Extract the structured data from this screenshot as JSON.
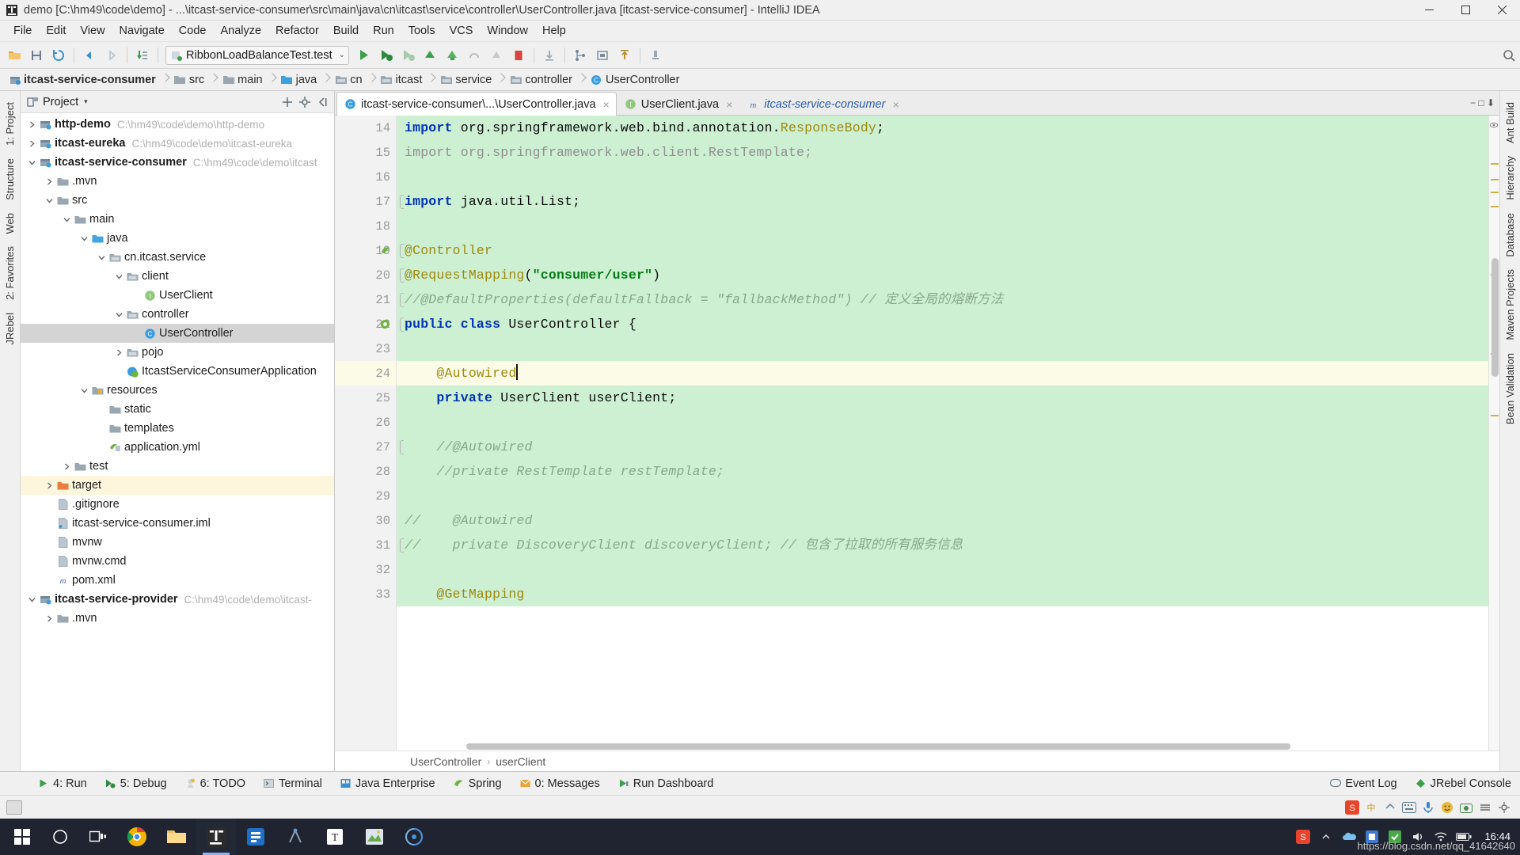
{
  "window": {
    "title": "demo [C:\\hm49\\code\\demo] - ...\\itcast-service-consumer\\src\\main\\java\\cn\\itcast\\service\\controller\\UserController.java [itcast-service-consumer] - IntelliJ IDEA",
    "minimize": "—",
    "maximize": "❐",
    "close": "✕"
  },
  "menu": [
    "File",
    "Edit",
    "View",
    "Navigate",
    "Code",
    "Analyze",
    "Refactor",
    "Build",
    "Run",
    "Tools",
    "VCS",
    "Window",
    "Help"
  ],
  "toolbar": {
    "run_config": "RibbonLoadBalanceTest.test",
    "dropdown_arrow": "⌄"
  },
  "breadcrumb": [
    {
      "label": "itcast-service-consumer",
      "icon": "module-icon",
      "bold": true
    },
    {
      "label": "src",
      "icon": "folder-icon",
      "bold": false
    },
    {
      "label": "main",
      "icon": "folder-icon",
      "bold": false
    },
    {
      "label": "java",
      "icon": "source-folder-icon",
      "bold": false
    },
    {
      "label": "cn",
      "icon": "package-icon",
      "bold": false
    },
    {
      "label": "itcast",
      "icon": "package-icon",
      "bold": false
    },
    {
      "label": "service",
      "icon": "package-icon",
      "bold": false
    },
    {
      "label": "controller",
      "icon": "package-icon",
      "bold": false
    },
    {
      "label": "UserController",
      "icon": "class-icon",
      "bold": false
    }
  ],
  "left_strip": [
    "1: Project",
    "Structure",
    "Web",
    "2: Favorites",
    "JRebel"
  ],
  "right_strip": [
    "Ant Build",
    "Hierarchy",
    "Database",
    "Maven Projects",
    "Bean Validation"
  ],
  "project_panel": {
    "title": "Project",
    "caret": "▾",
    "tree": [
      {
        "depth": 0,
        "arrow": "right",
        "icon": "module-icon",
        "label": "http-demo",
        "path": "C:\\hm49\\code\\demo\\http-demo",
        "bold": true,
        "state": ""
      },
      {
        "depth": 0,
        "arrow": "right",
        "icon": "module-icon",
        "label": "itcast-eureka",
        "path": "C:\\hm49\\code\\demo\\itcast-eureka",
        "bold": true,
        "state": ""
      },
      {
        "depth": 0,
        "arrow": "down",
        "icon": "module-icon",
        "label": "itcast-service-consumer",
        "path": "C:\\hm49\\code\\demo\\itcast",
        "bold": true,
        "state": ""
      },
      {
        "depth": 1,
        "arrow": "right",
        "icon": "folder-icon",
        "label": ".mvn",
        "path": "",
        "bold": false,
        "state": ""
      },
      {
        "depth": 1,
        "arrow": "down",
        "icon": "folder-icon",
        "label": "src",
        "path": "",
        "bold": false,
        "state": ""
      },
      {
        "depth": 2,
        "arrow": "down",
        "icon": "folder-icon",
        "label": "main",
        "path": "",
        "bold": false,
        "state": ""
      },
      {
        "depth": 3,
        "arrow": "down",
        "icon": "source-folder-icon",
        "label": "java",
        "path": "",
        "bold": false,
        "state": ""
      },
      {
        "depth": 4,
        "arrow": "down",
        "icon": "package-icon",
        "label": "cn.itcast.service",
        "path": "",
        "bold": false,
        "state": ""
      },
      {
        "depth": 5,
        "arrow": "down",
        "icon": "package-icon",
        "label": "client",
        "path": "",
        "bold": false,
        "state": ""
      },
      {
        "depth": 6,
        "arrow": "none",
        "icon": "interface-icon",
        "label": "UserClient",
        "path": "",
        "bold": false,
        "state": ""
      },
      {
        "depth": 5,
        "arrow": "down",
        "icon": "package-icon",
        "label": "controller",
        "path": "",
        "bold": false,
        "state": ""
      },
      {
        "depth": 6,
        "arrow": "none",
        "icon": "class-icon",
        "label": "UserController",
        "path": "",
        "bold": false,
        "state": "selected"
      },
      {
        "depth": 5,
        "arrow": "right",
        "icon": "package-icon",
        "label": "pojo",
        "path": "",
        "bold": false,
        "state": ""
      },
      {
        "depth": 5,
        "arrow": "none",
        "icon": "spring-class-icon",
        "label": "ItcastServiceConsumerApplication",
        "path": "",
        "bold": false,
        "state": ""
      },
      {
        "depth": 3,
        "arrow": "down",
        "icon": "resources-icon",
        "label": "resources",
        "path": "",
        "bold": false,
        "state": ""
      },
      {
        "depth": 4,
        "arrow": "none",
        "icon": "folder-icon",
        "label": "static",
        "path": "",
        "bold": false,
        "state": ""
      },
      {
        "depth": 4,
        "arrow": "none",
        "icon": "folder-icon",
        "label": "templates",
        "path": "",
        "bold": false,
        "state": ""
      },
      {
        "depth": 4,
        "arrow": "none",
        "icon": "yml-icon",
        "label": "application.yml",
        "path": "",
        "bold": false,
        "state": ""
      },
      {
        "depth": 2,
        "arrow": "right",
        "icon": "folder-icon",
        "label": "test",
        "path": "",
        "bold": false,
        "state": ""
      },
      {
        "depth": 1,
        "arrow": "right",
        "icon": "target-folder-icon",
        "label": "target",
        "path": "",
        "bold": false,
        "state": "highlight"
      },
      {
        "depth": 1,
        "arrow": "none",
        "icon": "file-icon",
        "label": ".gitignore",
        "path": "",
        "bold": false,
        "state": ""
      },
      {
        "depth": 1,
        "arrow": "none",
        "icon": "iml-icon",
        "label": "itcast-service-consumer.iml",
        "path": "",
        "bold": false,
        "state": ""
      },
      {
        "depth": 1,
        "arrow": "none",
        "icon": "file-icon",
        "label": "mvnw",
        "path": "",
        "bold": false,
        "state": ""
      },
      {
        "depth": 1,
        "arrow": "none",
        "icon": "file-icon",
        "label": "mvnw.cmd",
        "path": "",
        "bold": false,
        "state": ""
      },
      {
        "depth": 1,
        "arrow": "none",
        "icon": "maven-icon",
        "label": "pom.xml",
        "path": "",
        "bold": false,
        "state": ""
      },
      {
        "depth": 0,
        "arrow": "down",
        "icon": "module-icon",
        "label": "itcast-service-provider",
        "path": "C:\\hm49\\code\\demo\\itcast-",
        "bold": true,
        "state": ""
      },
      {
        "depth": 1,
        "arrow": "right",
        "icon": "folder-icon",
        "label": ".mvn",
        "path": "",
        "bold": false,
        "state": ""
      }
    ]
  },
  "editor": {
    "tabs": [
      {
        "label": "itcast-service-consumer\\...\\UserController.java",
        "icon": "class-icon",
        "active": true,
        "close": "×",
        "italic": false
      },
      {
        "label": "UserClient.java",
        "icon": "interface-icon",
        "active": false,
        "close": "×",
        "italic": false
      },
      {
        "label": "itcast-service-consumer",
        "icon": "maven-icon",
        "active": false,
        "close": "×",
        "italic": true
      }
    ],
    "tabs_right": "− □ ⬇",
    "first_line_number": 14,
    "lines": [
      {
        "n": 14,
        "fold": false,
        "mark": "",
        "current": false,
        "tokens": [
          {
            "t": "import ",
            "c": "kw"
          },
          {
            "t": "org.springframework.web.bind.annotation.",
            "c": "pl"
          },
          {
            "t": "ResponseBody",
            "c": "an"
          },
          {
            "t": ";",
            "c": "pl"
          }
        ]
      },
      {
        "n": 15,
        "fold": false,
        "mark": "",
        "current": false,
        "tokens": [
          {
            "t": "import ",
            "c": "grey"
          },
          {
            "t": "org.springframework.web.client.RestTemplate;",
            "c": "grey"
          }
        ]
      },
      {
        "n": 16,
        "fold": false,
        "mark": "",
        "current": false,
        "tokens": []
      },
      {
        "n": 17,
        "fold": true,
        "mark": "",
        "current": false,
        "tokens": [
          {
            "t": "import ",
            "c": "kw"
          },
          {
            "t": "java.util.List;",
            "c": "pl"
          }
        ]
      },
      {
        "n": 18,
        "fold": false,
        "mark": "",
        "current": false,
        "tokens": []
      },
      {
        "n": 19,
        "fold": true,
        "mark": "spring",
        "current": false,
        "tokens": [
          {
            "t": "@Controller",
            "c": "an"
          }
        ]
      },
      {
        "n": 20,
        "fold": true,
        "mark": "",
        "current": false,
        "tokens": [
          {
            "t": "@RequestMapping",
            "c": "an"
          },
          {
            "t": "(",
            "c": "pl"
          },
          {
            "t": "\"consumer/user\"",
            "c": "st"
          },
          {
            "t": ")",
            "c": "pl"
          }
        ]
      },
      {
        "n": 21,
        "fold": true,
        "mark": "",
        "current": false,
        "tokens": [
          {
            "t": "//@DefaultProperties(defaultFallback = \"fallbackMethod\") // 定义全局的熔断方法",
            "c": "cmg"
          }
        ]
      },
      {
        "n": 22,
        "fold": true,
        "mark": "spring-bean",
        "current": false,
        "tokens": [
          {
            "t": "public class ",
            "c": "kw"
          },
          {
            "t": "UserController ",
            "c": "pl"
          },
          {
            "t": "{",
            "c": "pl"
          }
        ]
      },
      {
        "n": 23,
        "fold": false,
        "mark": "",
        "current": false,
        "tokens": []
      },
      {
        "n": 24,
        "fold": false,
        "mark": "",
        "current": true,
        "tokens": [
          {
            "t": "    @Autowired",
            "c": "an"
          }
        ]
      },
      {
        "n": 25,
        "fold": false,
        "mark": "",
        "current": false,
        "tokens": [
          {
            "t": "    private ",
            "c": "kw"
          },
          {
            "t": "UserClient userClient;",
            "c": "pl"
          }
        ]
      },
      {
        "n": 26,
        "fold": false,
        "mark": "",
        "current": false,
        "tokens": []
      },
      {
        "n": 27,
        "fold": true,
        "mark": "",
        "current": false,
        "tokens": [
          {
            "t": "    //@Autowired",
            "c": "cmg"
          }
        ]
      },
      {
        "n": 28,
        "fold": false,
        "mark": "",
        "current": false,
        "tokens": [
          {
            "t": "    //private RestTemplate restTemplate;",
            "c": "cmg"
          }
        ]
      },
      {
        "n": 29,
        "fold": false,
        "mark": "",
        "current": false,
        "tokens": []
      },
      {
        "n": 30,
        "fold": false,
        "mark": "",
        "current": false,
        "tokens": [
          {
            "t": "//    @Autowired",
            "c": "cmg"
          }
        ]
      },
      {
        "n": 31,
        "fold": true,
        "mark": "",
        "current": false,
        "tokens": [
          {
            "t": "//    private DiscoveryClient discoveryClient; // 包含了拉取的所有服务信息",
            "c": "cmg"
          }
        ]
      },
      {
        "n": 32,
        "fold": false,
        "mark": "",
        "current": false,
        "tokens": []
      },
      {
        "n": 33,
        "fold": false,
        "mark": "",
        "current": false,
        "tokens": [
          {
            "t": "    @GetMapping",
            "c": "an"
          }
        ]
      }
    ],
    "footer_crumbs": [
      "UserController",
      "userClient"
    ],
    "footer_sep": "›"
  },
  "tool_windows": [
    {
      "label": "4: Run",
      "icon": "run-icon"
    },
    {
      "label": "5: Debug",
      "icon": "debug-icon"
    },
    {
      "label": "6: TODO",
      "icon": "todo-icon"
    },
    {
      "label": "Terminal",
      "icon": "terminal-icon"
    },
    {
      "label": "Java Enterprise",
      "icon": "java-enterprise-icon"
    },
    {
      "label": "Spring",
      "icon": "spring-icon"
    },
    {
      "label": "0: Messages",
      "icon": "messages-icon"
    },
    {
      "label": "Run Dashboard",
      "icon": "run-dashboard-icon"
    }
  ],
  "status_right": [
    {
      "label": "Event Log",
      "icon": "event-log-icon"
    },
    {
      "label": "JRebel Console",
      "icon": "jrebel-icon"
    }
  ],
  "taskbar": {
    "clock_time": "16:44",
    "clock_date": "",
    "ime": "中"
  },
  "watermark": "https://blog.csdn.net/qq_41642640",
  "colors": {
    "accent": "#3b7ddd",
    "diff_green": "#cdf0d3",
    "current_line": "#fcfbe8",
    "selection_grey": "#d4d4d4",
    "highlight_cream": "#fdf6dd",
    "keyword_blue": "#0033b3",
    "annotation_yellow": "#9e880d",
    "string_green": "#067d17",
    "comment_grey": "#8c8c8c"
  }
}
